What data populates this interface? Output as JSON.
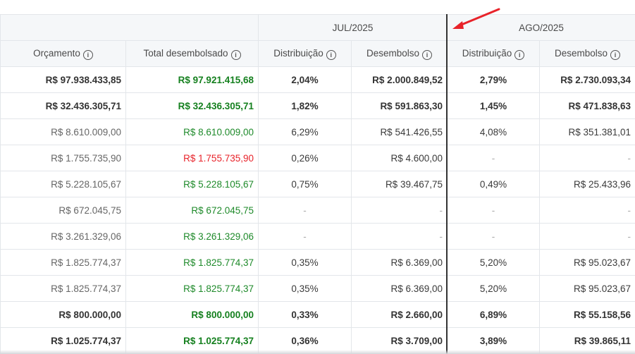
{
  "groups": {
    "jul": "JUL/2025",
    "ago": "AGO/2025"
  },
  "headers": {
    "orcamento": "Orçamento",
    "total": "Total desembolsado",
    "jul_dist": "Distribuição",
    "jul_des": "Desembolso",
    "ago_dist": "Distribuição",
    "ago_des": "Desembolso"
  },
  "icons": {
    "info": "info-circle-icon",
    "arrow": "red-arrow-icon"
  },
  "colors": {
    "green": "#1e8a2a",
    "red": "#e8232a",
    "divider": "#333333"
  },
  "rows": [
    {
      "bold": true,
      "orcamento": "R$ 97.938.433,85",
      "total": "R$ 97.921.415,68",
      "total_color": "green",
      "jul_dist": "2,04%",
      "jul_des": "R$ 2.000.849,52",
      "ago_dist": "2,79%",
      "ago_des": "R$ 2.730.093,34"
    },
    {
      "bold": true,
      "orcamento": "R$ 32.436.305,71",
      "total": "R$ 32.436.305,71",
      "total_color": "green",
      "jul_dist": "1,82%",
      "jul_des": "R$ 591.863,30",
      "ago_dist": "1,45%",
      "ago_des": "R$ 471.838,63"
    },
    {
      "bold": false,
      "orcamento": "R$ 8.610.009,00",
      "total": "R$ 8.610.009,00",
      "total_color": "green",
      "jul_dist": "6,29%",
      "jul_des": "R$ 541.426,55",
      "ago_dist": "4,08%",
      "ago_des": "R$ 351.381,01"
    },
    {
      "bold": false,
      "orcamento": "R$ 1.755.735,90",
      "total": "R$ 1.755.735,90",
      "total_color": "red",
      "jul_dist": "0,26%",
      "jul_des": "R$ 4.600,00",
      "ago_dist": "-",
      "ago_des": "-"
    },
    {
      "bold": false,
      "orcamento": "R$ 5.228.105,67",
      "total": "R$ 5.228.105,67",
      "total_color": "green",
      "jul_dist": "0,75%",
      "jul_des": "R$ 39.467,75",
      "ago_dist": "0,49%",
      "ago_des": "R$ 25.433,96"
    },
    {
      "bold": false,
      "orcamento": "R$ 672.045,75",
      "total": "R$ 672.045,75",
      "total_color": "green",
      "jul_dist": "-",
      "jul_des": "-",
      "ago_dist": "-",
      "ago_des": "-"
    },
    {
      "bold": false,
      "orcamento": "R$ 3.261.329,06",
      "total": "R$ 3.261.329,06",
      "total_color": "green",
      "jul_dist": "-",
      "jul_des": "-",
      "ago_dist": "-",
      "ago_des": "-"
    },
    {
      "bold": false,
      "orcamento": "R$ 1.825.774,37",
      "total": "R$ 1.825.774,37",
      "total_color": "green",
      "jul_dist": "0,35%",
      "jul_des": "R$ 6.369,00",
      "ago_dist": "5,20%",
      "ago_des": "R$ 95.023,67"
    },
    {
      "bold": false,
      "orcamento": "R$ 1.825.774,37",
      "total": "R$ 1.825.774,37",
      "total_color": "green",
      "jul_dist": "0,35%",
      "jul_des": "R$ 6.369,00",
      "ago_dist": "5,20%",
      "ago_des": "R$ 95.023,67"
    },
    {
      "bold": true,
      "orcamento": "R$ 800.000,00",
      "total": "R$ 800.000,00",
      "total_color": "green",
      "jul_dist": "0,33%",
      "jul_des": "R$ 2.660,00",
      "ago_dist": "6,89%",
      "ago_des": "R$ 55.158,56"
    },
    {
      "bold": true,
      "orcamento": "R$ 1.025.774,37",
      "total": "R$ 1.025.774,37",
      "total_color": "green",
      "jul_dist": "0,36%",
      "jul_des": "R$ 3.709,00",
      "ago_dist": "3,89%",
      "ago_des": "R$ 39.865,11"
    }
  ]
}
